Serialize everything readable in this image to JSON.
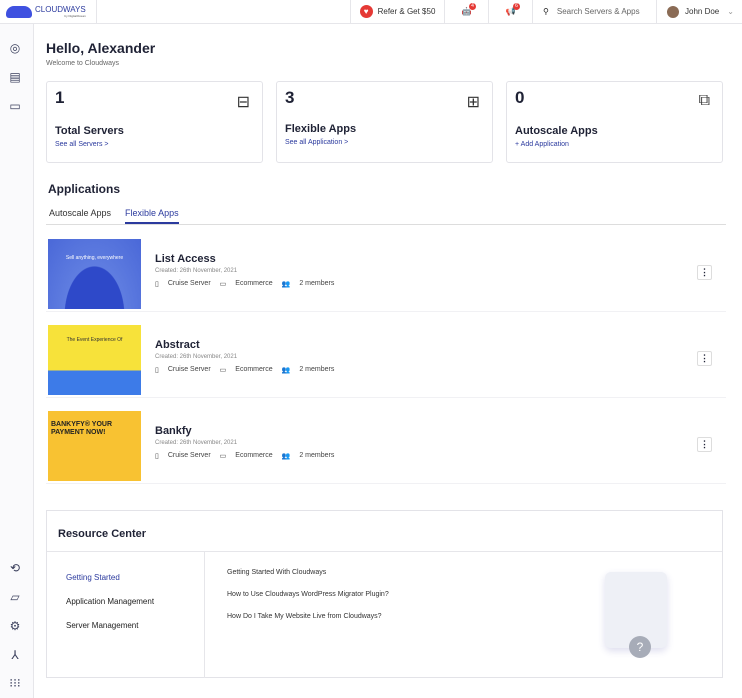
{
  "header": {
    "logo": "CLOUDWAYS",
    "logo_sub": "by DigitalOcean",
    "refer": "Refer & Get $50",
    "bot_badge": "4",
    "announce_badge": "6",
    "search_placeholder": "Search Servers & Apps",
    "user": "John Doe"
  },
  "greeting": {
    "title": "Hello, Alexander",
    "subtitle": "Welcome to Cloudways"
  },
  "cards": [
    {
      "count": "1",
      "label": "Total Servers",
      "link": "See all Servers >",
      "icon": "server-icon"
    },
    {
      "count": "3",
      "label": "Flexible Apps",
      "link": "See all Application >",
      "icon": "apps-icon"
    },
    {
      "count": "0",
      "label": "Autoscale Apps",
      "link": "+ Add Application",
      "icon": "autoscale-icon"
    }
  ],
  "applications": {
    "title": "Applications",
    "tabs": [
      "Autoscale Apps",
      "Flexible Apps"
    ],
    "active_tab": "Flexible Apps",
    "items": [
      {
        "name": "List Access",
        "created": "Created: 26th November, 2021",
        "server": "Cruise Server",
        "project": "Ecommerce",
        "members": "2 members",
        "thumb_text": "Sell anything, everywhere"
      },
      {
        "name": "Abstract",
        "created": "Created: 26th November, 2021",
        "server": "Cruise Server",
        "project": "Ecommerce",
        "members": "2 members",
        "thumb_text": "The Event Experience Of"
      },
      {
        "name": "Bankfy",
        "created": "Created: 26th November, 2021",
        "server": "Cruise Server",
        "project": "Ecommerce",
        "members": "2 members",
        "thumb_text": "BANKYFY® YOUR PAYMENT NOW!"
      }
    ]
  },
  "resource_center": {
    "title": "Resource Center",
    "categories": [
      "Getting Started",
      "Application Management",
      "Server Management"
    ],
    "active": "Getting Started",
    "links": [
      "Getting Started With Cloudways",
      "How to Use Cloudways WordPress Migrator Plugin?",
      "How Do I Take My Website Live from Cloudways?"
    ]
  },
  "colors": {
    "accent": "#2b3a9e",
    "badge": "#e53935"
  }
}
